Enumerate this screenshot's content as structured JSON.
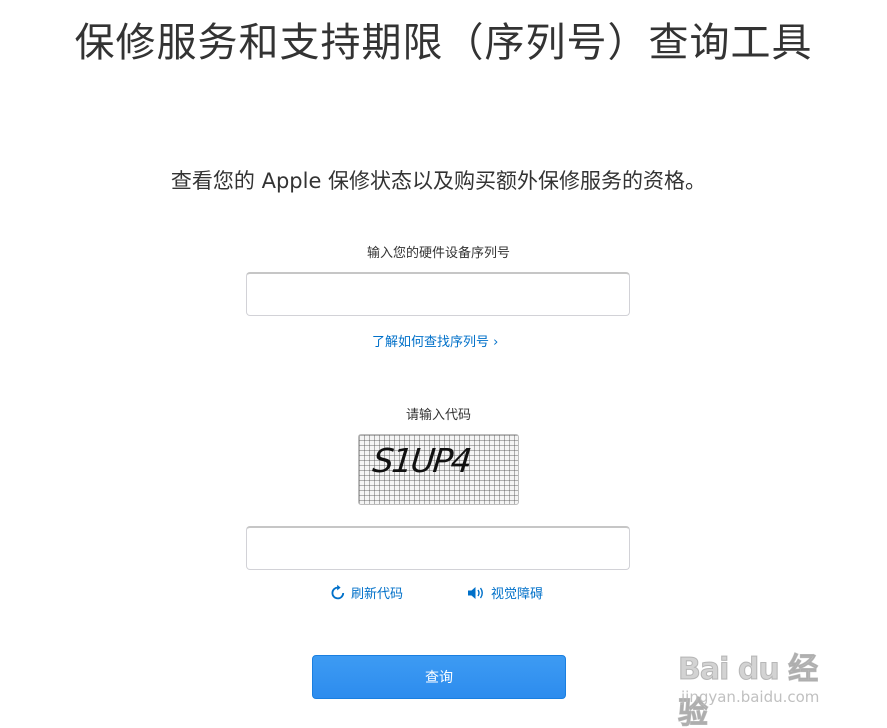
{
  "header": {
    "title": "保修服务和支持期限（序列号）查询工具",
    "subtitle": "查看您的 Apple 保修状态以及购买额外保修服务的资格。"
  },
  "serial": {
    "label": "输入您的硬件设备序列号",
    "value": "",
    "help_link": "了解如何查找序列号 ›"
  },
  "captcha": {
    "label": "请输入代码",
    "image_text": "S1UP4",
    "value": "",
    "refresh_label": "刷新代码",
    "refresh_icon": "refresh-icon",
    "audio_label": "视觉障碍",
    "audio_icon": "speaker-icon"
  },
  "submit": {
    "label": "查询"
  },
  "watermark": {
    "brand": "Bai du 经验",
    "url": "jingyan.baidu.com"
  },
  "colors": {
    "link": "#0070c9",
    "button": "#2d8cee",
    "text": "#333333"
  }
}
